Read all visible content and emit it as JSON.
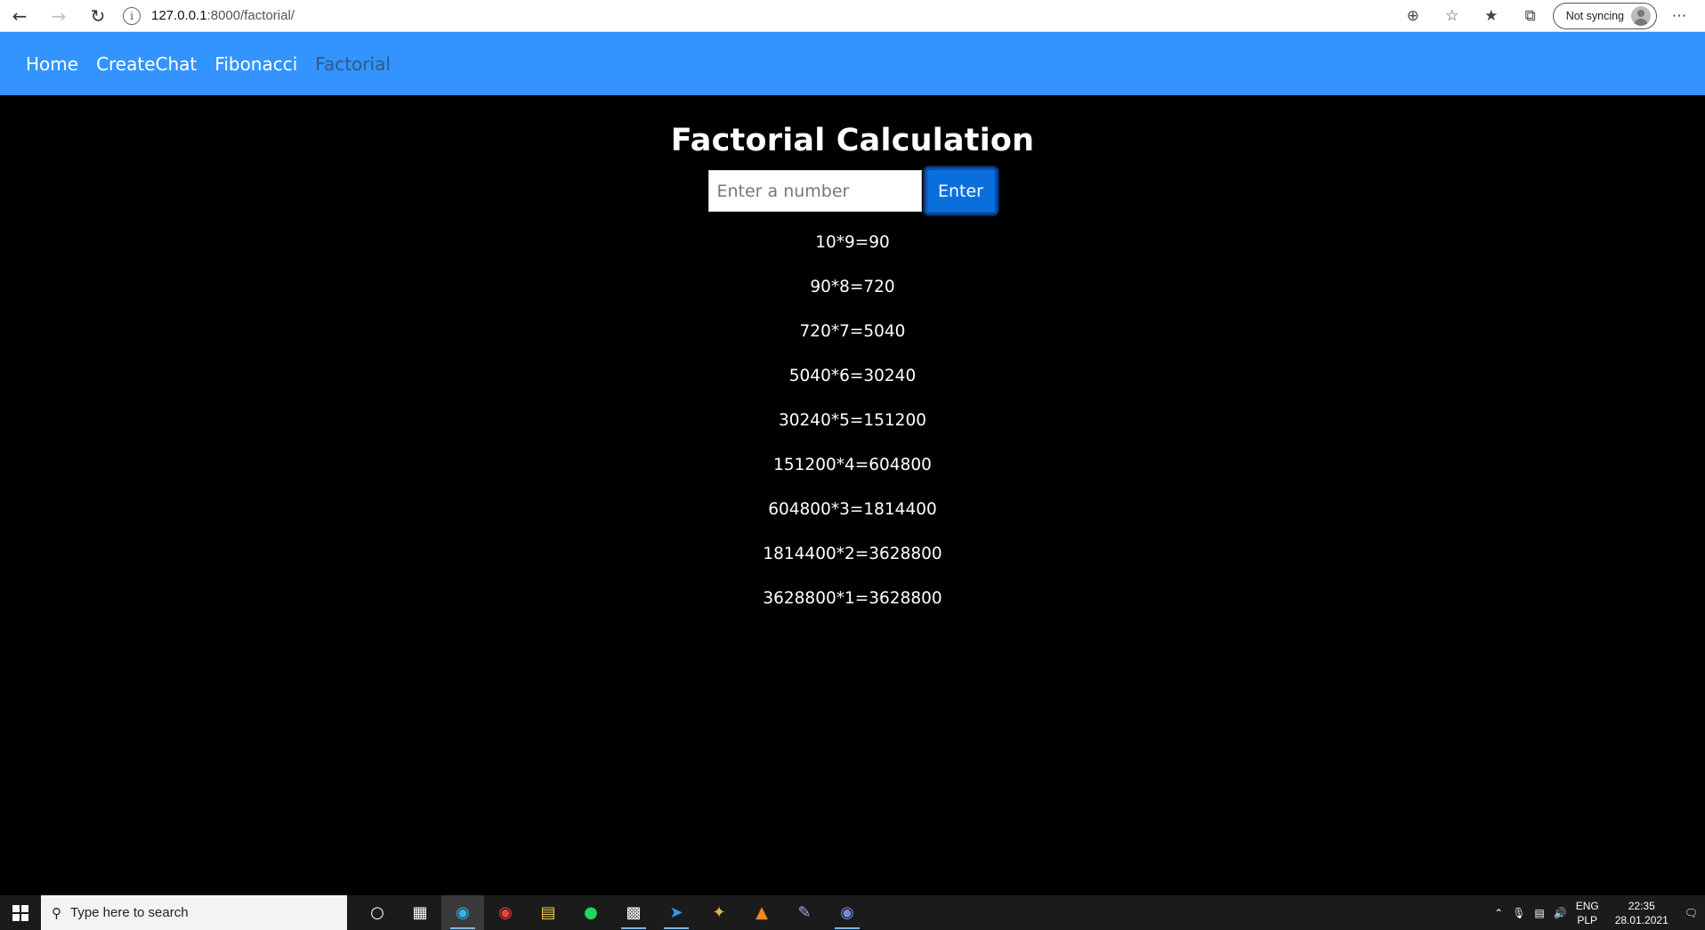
{
  "browser": {
    "url_host": "127.0.0.1",
    "url_path": ":8000/factorial/",
    "sync_label": "Not syncing"
  },
  "navbar": {
    "items": [
      {
        "label": "Home"
      },
      {
        "label": "CreateChat"
      },
      {
        "label": "Fibonacci"
      },
      {
        "label": "Factorial"
      }
    ]
  },
  "main": {
    "title": "Factorial Calculation",
    "input_placeholder": "Enter a number",
    "button_label": "Enter",
    "results": [
      "10*9=90",
      "90*8=720",
      "720*7=5040",
      "5040*6=30240",
      "30240*5=151200",
      "151200*4=604800",
      "604800*3=1814400",
      "1814400*2=3628800",
      "3628800*1=3628800"
    ]
  },
  "taskbar": {
    "search_placeholder": "Type here to search",
    "lang_top": "ENG",
    "lang_bottom": "PLP",
    "time": "22:35",
    "date": "28.01.2021"
  },
  "colors": {
    "navbar_bg": "#3394ff",
    "page_bg": "#000000",
    "button_bg": "#0a6fdd"
  }
}
